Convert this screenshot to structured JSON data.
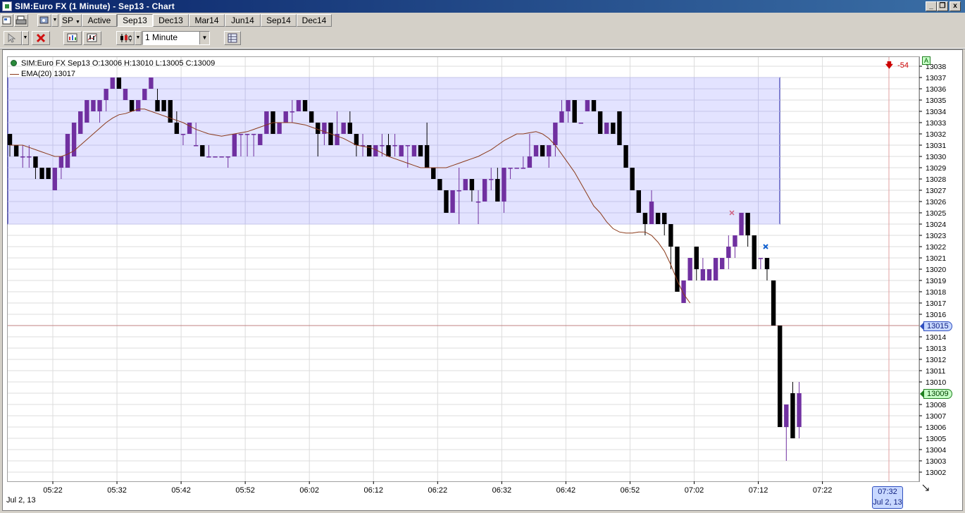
{
  "window": {
    "title": "SIM:Euro FX (1 Minute) - Sep13 - Chart",
    "minimize_glyph": "_",
    "restore_glyph": "❐",
    "close_glyph": "x"
  },
  "toolbar": {
    "instrument_label": "SP",
    "tabs": [
      {
        "label": "Active",
        "selected": false
      },
      {
        "label": "Sep13",
        "selected": true
      },
      {
        "label": "Dec13",
        "selected": false
      },
      {
        "label": "Mar14",
        "selected": false
      },
      {
        "label": "Jun14",
        "selected": false
      },
      {
        "label": "Sep14",
        "selected": false
      },
      {
        "label": "Dec14",
        "selected": false
      }
    ],
    "interval_value": "1 Minute",
    "icons": [
      "properties-icon",
      "print-icon",
      "gear-icon",
      "cursor-icon",
      "delete-icon",
      "instrument-icon",
      "indicator-icon",
      "bar-style-icon",
      "data-box-icon"
    ]
  },
  "legend": {
    "ohlc": "SIM:Euro FX Sep13 O:13006 H:13010 L:13005 C:13009",
    "ema": "EMA(20)  13017"
  },
  "pnl_value": "-54",
  "price_axis": {
    "labels": [
      "13038",
      "13037",
      "13036",
      "13035",
      "13034",
      "13033",
      "13032",
      "13031",
      "13030",
      "13029",
      "13028",
      "13027",
      "13026",
      "13025",
      "13024",
      "13023",
      "13022",
      "13021",
      "13020",
      "13019",
      "13018",
      "13017",
      "13016",
      "13014",
      "13013",
      "13012",
      "13011",
      "13010",
      "13008",
      "13007",
      "13006",
      "13005",
      "13004",
      "13003",
      "13002"
    ],
    "current_line_price": "13015",
    "last_price": "13009",
    "scale_badge": "A"
  },
  "time_axis": {
    "labels": [
      "05:22",
      "05:32",
      "05:42",
      "05:52",
      "06:02",
      "06:12",
      "06:22",
      "06:32",
      "06:42",
      "06:52",
      "07:02",
      "07:12",
      "07:22"
    ],
    "start_date": "Jul 2, 13",
    "cursor_time": "07:32",
    "cursor_date": "Jul 2, 13"
  },
  "chart_data": {
    "type": "candlestick",
    "ylim": [
      13002,
      13038
    ],
    "up_color": "#7030a0",
    "down_color": "#000000",
    "ema_color": "#8b3a1a",
    "zone_color": "#dcdcff",
    "zone_border": "#1010a0",
    "zone_range": [
      13024,
      13037
    ],
    "ema_series": [
      13031,
      13031,
      13031,
      13030.8,
      13030.6,
      13030.4,
      13030.2,
      13030,
      13030,
      13030.2,
      13030.5,
      13031,
      13031.5,
      13032,
      13032.5,
      13033,
      13033.4,
      13033.7,
      13033.8,
      13034,
      13034.2,
      13034.2,
      13034,
      13033.8,
      13033.6,
      13033.4,
      13033.2,
      13033,
      13032.7,
      13032.4,
      13032.2,
      13032,
      13031.9,
      13031.8,
      13031.9,
      13032,
      13032.1,
      13032.2,
      13032.4,
      13032.6,
      13032.8,
      13033,
      13033,
      13033,
      13033,
      13032.9,
      13032.8,
      13032.6,
      13032.4,
      13032.2,
      13032,
      13031.8,
      13031.6,
      13031.3,
      13031,
      13030.9,
      13030.8,
      13030.6,
      13030.3,
      13030,
      13029.8,
      13029.6,
      13029.4,
      13029.2,
      13029,
      13029,
      13029,
      13029,
      13029,
      13029.2,
      13029.4,
      13029.6,
      13029.8,
      13030,
      13030.3,
      13030.6,
      13031,
      13031.4,
      13031.7,
      13032,
      13032,
      13032.1,
      13032.2,
      13032,
      13031.6,
      13031,
      13030.2,
      13029.4,
      13028.6,
      13027.6,
      13026.6,
      13025.6,
      13025,
      13024.2,
      13023.6,
      13023.3,
      13023.2,
      13023.2,
      13023.3,
      13023.3,
      13023,
      13022.4,
      13021.6,
      13020.4,
      13019,
      13017.8,
      13017
    ],
    "candles": [
      [
        13032,
        13032,
        13030,
        13031
      ],
      [
        13031,
        13031,
        13030,
        13030
      ],
      [
        13030,
        13031,
        13029,
        13030
      ],
      [
        13030,
        13031,
        13029,
        13030
      ],
      [
        13030,
        13030,
        13028,
        13029
      ],
      [
        13029,
        13029,
        13028,
        13028
      ],
      [
        13029,
        13029,
        13028,
        13028
      ],
      [
        13027,
        13029,
        13027,
        13029
      ],
      [
        13029,
        13030,
        13028,
        13030
      ],
      [
        13029,
        13032,
        13029,
        13032
      ],
      [
        13030,
        13033,
        13030,
        13033
      ],
      [
        13032,
        13034,
        13032,
        13034
      ],
      [
        13033,
        13035,
        13033,
        13035
      ],
      [
        13034,
        13035,
        13034,
        13035
      ],
      [
        13034,
        13035,
        13033,
        13035
      ],
      [
        13035,
        13036,
        13034,
        13036
      ],
      [
        13036,
        13037,
        13036,
        13037
      ],
      [
        13037,
        13037,
        13036,
        13036
      ],
      [
        13035,
        13036,
        13035,
        13036
      ],
      [
        13035,
        13035,
        13034,
        13034
      ],
      [
        13034,
        13035,
        13034,
        13035
      ],
      [
        13035,
        13036,
        13035,
        13036
      ],
      [
        13036,
        13037,
        13036,
        13037
      ],
      [
        13035,
        13036,
        13034,
        13034
      ],
      [
        13035,
        13035,
        13034,
        13034
      ],
      [
        13035,
        13035,
        13033,
        13033
      ],
      [
        13033,
        13034,
        13032,
        13032
      ],
      [
        13032,
        13032,
        13031,
        13032
      ],
      [
        13032,
        13033,
        13032,
        13033
      ],
      [
        13031,
        13033,
        13031,
        13031
      ],
      [
        13031,
        13031,
        13030,
        13030
      ],
      [
        13030,
        13031,
        13030,
        13030
      ],
      [
        13030,
        13030,
        13030,
        13030
      ],
      [
        13030,
        13030,
        13030,
        13030
      ],
      [
        13030,
        13030,
        13029,
        13030
      ],
      [
        13030,
        13032,
        13030,
        13032
      ],
      [
        13032,
        13032,
        13030,
        13032
      ],
      [
        13032,
        13032,
        13030,
        13032
      ],
      [
        13032,
        13032,
        13030,
        13032
      ],
      [
        13031,
        13032,
        13031,
        13032
      ],
      [
        13032,
        13034,
        13032,
        13034
      ],
      [
        13034,
        13034,
        13032,
        13032
      ],
      [
        13032,
        13033,
        13032,
        13033
      ],
      [
        13033,
        13034,
        13033,
        13034
      ],
      [
        13034,
        13035,
        13033,
        13034
      ],
      [
        13034,
        13035,
        13034,
        13035
      ],
      [
        13035,
        13035,
        13034,
        13034
      ],
      [
        13034,
        13034,
        13033,
        13033
      ],
      [
        13033,
        13033,
        13030,
        13032
      ],
      [
        13032,
        13033,
        13031,
        13033
      ],
      [
        13033,
        13033,
        13031,
        13031
      ],
      [
        13031,
        13034,
        13031,
        13032
      ],
      [
        13032,
        13033,
        13032,
        13033
      ],
      [
        13033,
        13034,
        13032,
        13032
      ],
      [
        13032,
        13032,
        13030,
        13031
      ],
      [
        13031,
        13032,
        13030,
        13031
      ],
      [
        13031,
        13031,
        13030,
        13030
      ],
      [
        13030,
        13031,
        13030,
        13031
      ],
      [
        13031,
        13032,
        13030,
        13031
      ],
      [
        13031,
        13032,
        13030,
        13030
      ],
      [
        13031,
        13032,
        13030,
        13031
      ],
      [
        13030,
        13031,
        13030,
        13031
      ],
      [
        13031,
        13031,
        13029,
        13031
      ],
      [
        13030,
        13031,
        13030,
        13031
      ],
      [
        13031,
        13031,
        13030,
        13030
      ],
      [
        13031,
        13033,
        13029,
        13029
      ],
      [
        13029,
        13029,
        13028,
        13028
      ],
      [
        13028,
        13028,
        13027,
        13027
      ],
      [
        13027,
        13027,
        13025,
        13025
      ],
      [
        13025,
        13027,
        13025,
        13027
      ],
      [
        13027,
        13029,
        13024,
        13027
      ],
      [
        13027,
        13028,
        13027,
        13028
      ],
      [
        13028,
        13028,
        13026,
        13027
      ],
      [
        13026,
        13027,
        13024,
        13026
      ],
      [
        13026,
        13028,
        13026,
        13028
      ],
      [
        13028,
        13029,
        13027,
        13028
      ],
      [
        13028,
        13029,
        13026,
        13026
      ],
      [
        13026,
        13029,
        13025,
        13029
      ],
      [
        13029,
        13029,
        13028,
        13029
      ],
      [
        13029,
        13029,
        13029,
        13029
      ],
      [
        13029,
        13030,
        13029,
        13029
      ],
      [
        13029,
        13032,
        13029,
        13030
      ],
      [
        13030,
        13031,
        13030,
        13031
      ],
      [
        13031,
        13031,
        13030,
        13030
      ],
      [
        13030,
        13031,
        13029,
        13031
      ],
      [
        13031,
        13033,
        13030,
        13033
      ],
      [
        13033,
        13035,
        13033,
        13034
      ],
      [
        13034,
        13035,
        13033,
        13035
      ],
      [
        13035,
        13035,
        13033,
        13033
      ],
      [
        13033,
        13033,
        13033,
        13033
      ],
      [
        13034,
        13035,
        13034,
        13035
      ],
      [
        13035,
        13035,
        13034,
        13034
      ],
      [
        13034,
        13034,
        13032,
        13032
      ],
      [
        13032,
        13033,
        13032,
        13033
      ],
      [
        13033,
        13033,
        13032,
        13032
      ],
      [
        13034,
        13034,
        13031,
        13031
      ],
      [
        13031,
        13031,
        13029,
        13029
      ],
      [
        13029,
        13029,
        13027,
        13027
      ],
      [
        13027,
        13027,
        13025,
        13025
      ],
      [
        13025,
        13025,
        13023,
        13024
      ],
      [
        13024,
        13027,
        13024,
        13026
      ],
      [
        13025,
        13025,
        13024,
        13024
      ],
      [
        13025,
        13025,
        13023,
        13024
      ],
      [
        13024,
        13024,
        13020,
        13022
      ],
      [
        13022,
        13022,
        13018,
        13018
      ],
      [
        13017,
        13019,
        13017,
        13019
      ],
      [
        13019,
        13021,
        13019,
        13021
      ],
      [
        13022,
        13022,
        13019,
        13020
      ],
      [
        13019,
        13021,
        13019,
        13020
      ],
      [
        13019,
        13020,
        13019,
        13020
      ],
      [
        13019,
        13021,
        13019,
        13021
      ],
      [
        13020,
        13021,
        13020,
        13021
      ],
      [
        13021,
        13023,
        13020,
        13022
      ],
      [
        13022,
        13023,
        13021,
        13023
      ],
      [
        13023,
        13025,
        13023,
        13025
      ],
      [
        13025,
        13025,
        13022,
        13023
      ],
      [
        13023,
        13023,
        13020,
        13020
      ],
      [
        13021,
        13021,
        13020,
        13021
      ],
      [
        13021,
        13021,
        13019,
        13020
      ],
      [
        13019,
        13019,
        13015,
        13015
      ],
      [
        13015,
        13015,
        13006,
        13006
      ],
      [
        13006,
        13008,
        13003,
        13008
      ],
      [
        13009,
        13010,
        13005,
        13005
      ],
      [
        13006,
        13010,
        13005,
        13009
      ]
    ]
  }
}
